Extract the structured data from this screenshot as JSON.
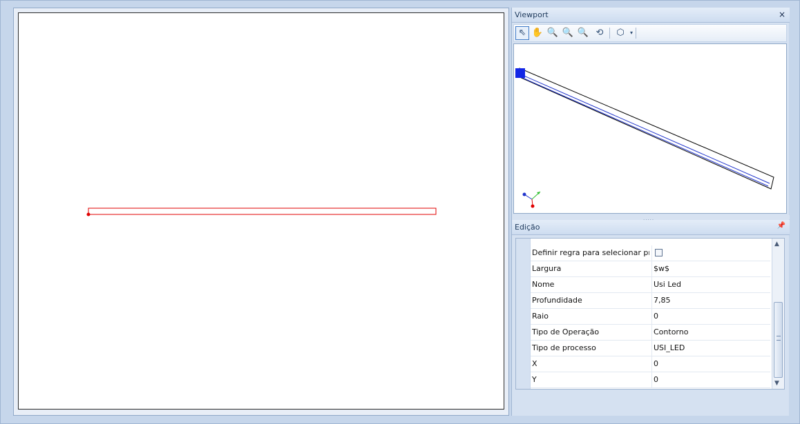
{
  "viewport": {
    "title": "Viewport",
    "close_icon": "×",
    "toolbar": [
      {
        "name": "select-tool-icon",
        "glyph": "⇖"
      },
      {
        "name": "pan-tool-icon",
        "glyph": "✋"
      },
      {
        "name": "zoom-extents-icon",
        "glyph": "🔍"
      },
      {
        "name": "zoom-window-icon",
        "glyph": "🔍"
      },
      {
        "name": "zoom-icon",
        "glyph": "🔍"
      },
      {
        "name": "orbit-icon",
        "glyph": "⟲"
      },
      {
        "name": "view-cube-icon",
        "glyph": "⬡"
      }
    ]
  },
  "edicao": {
    "title": "Edição",
    "pin_icon": "📌",
    "properties": [
      {
        "name": "Definir regra para selecionar pro...",
        "value": "",
        "type": "checkbox"
      },
      {
        "name": "Largura",
        "value": "$w$"
      },
      {
        "name": "Nome",
        "value": "Usi Led"
      },
      {
        "name": "Profundidade",
        "value": "7,85"
      },
      {
        "name": "Raio",
        "value": "0"
      },
      {
        "name": "Tipo de Operação",
        "value": "Contorno"
      },
      {
        "name": "Tipo de processo",
        "value": "USI_LED"
      },
      {
        "name": "X",
        "value": "0"
      },
      {
        "name": "Y",
        "value": "0"
      }
    ]
  },
  "colors": {
    "accent": "#3f7ac7",
    "drawing_red": "#e00000",
    "drawing_blue": "#1f33cc"
  }
}
